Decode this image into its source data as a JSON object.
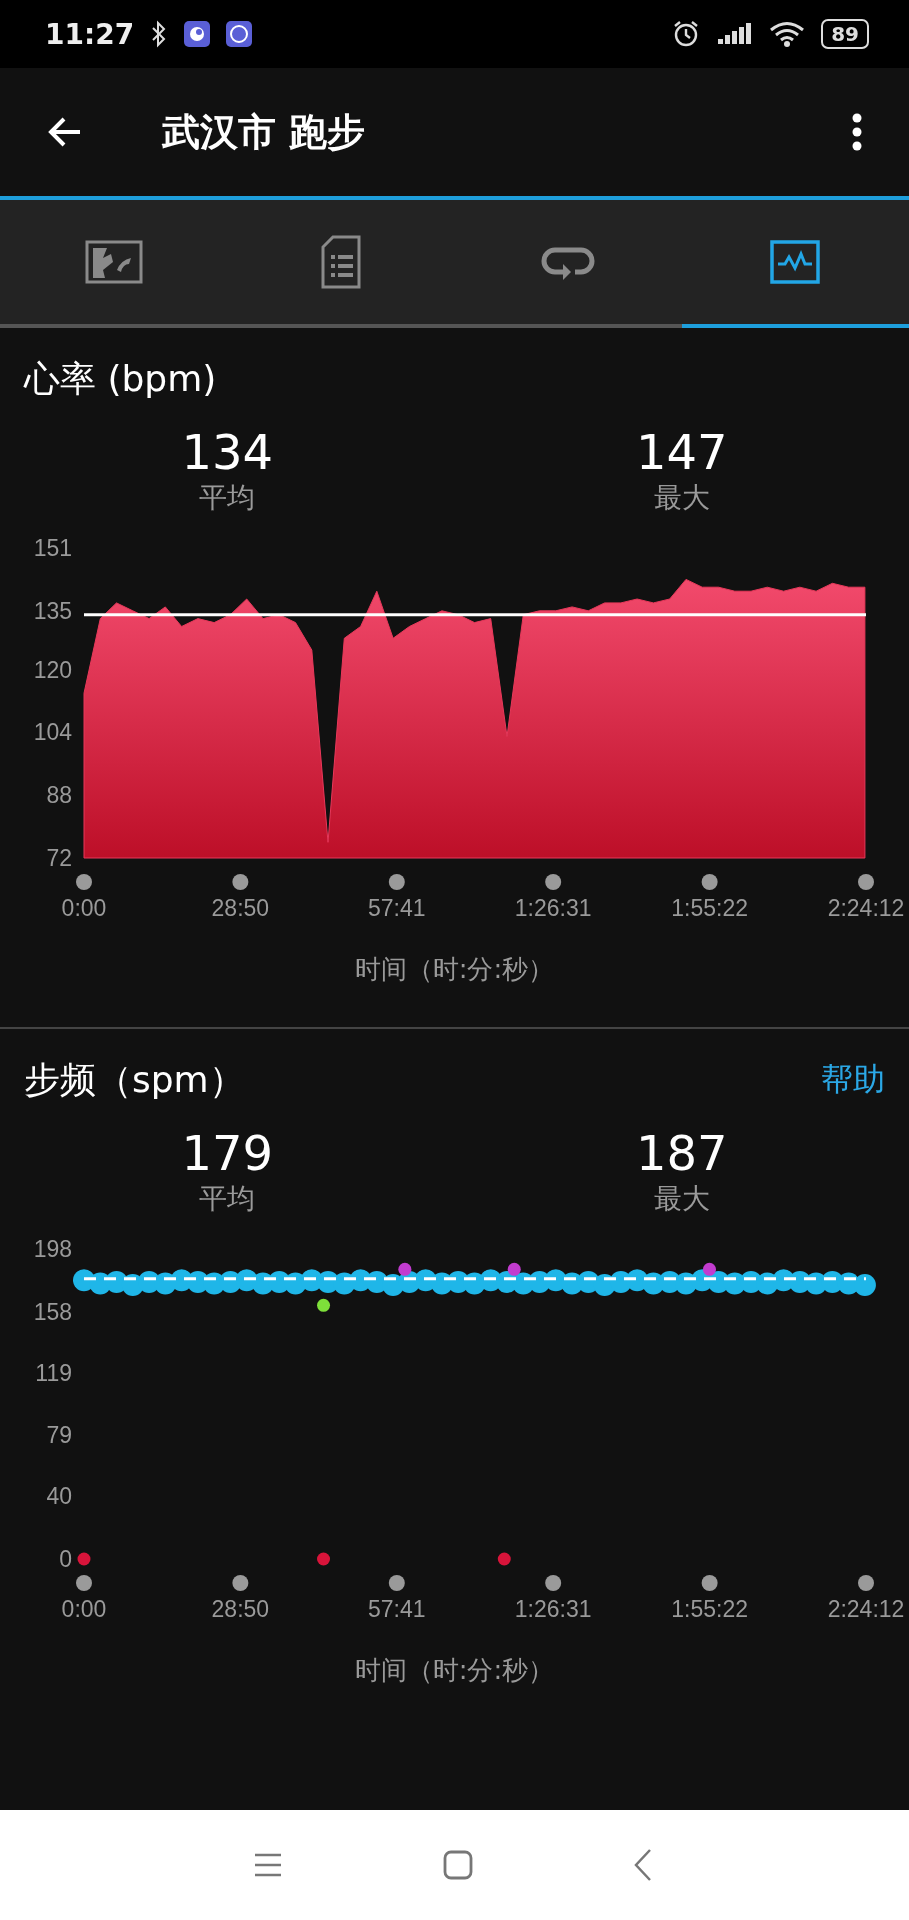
{
  "status_bar": {
    "time": "11:27",
    "battery": "89"
  },
  "header": {
    "title": "武汉市 跑步"
  },
  "tabs": [
    {
      "kind": "map",
      "selected": false
    },
    {
      "kind": "details",
      "selected": false
    },
    {
      "kind": "laps",
      "selected": false
    },
    {
      "kind": "charts",
      "selected": true
    }
  ],
  "sections": [
    {
      "title": "心率 (bpm)",
      "stats": [
        {
          "value": "134",
          "label": "平均"
        },
        {
          "value": "147",
          "label": "最大"
        }
      ],
      "chart_data": {
        "type": "area",
        "xlabel": "时间（时:分:秒）",
        "xlim": [
          0,
          8652
        ],
        "ylim": [
          72,
          151
        ],
        "yticks": [
          72,
          88,
          104,
          120,
          135,
          151
        ],
        "xticks": [
          {
            "value": 0,
            "label": "0:00"
          },
          {
            "value": 1730,
            "label": "28:50"
          },
          {
            "value": 3461,
            "label": "57:41"
          },
          {
            "value": 5191,
            "label": "1:26:31"
          },
          {
            "value": 6922,
            "label": "1:55:22"
          },
          {
            "value": 8652,
            "label": "2:24:12"
          }
        ],
        "x": [
          0,
          180,
          360,
          540,
          720,
          900,
          1080,
          1260,
          1440,
          1620,
          1800,
          1980,
          2160,
          2340,
          2520,
          2700,
          2880,
          3060,
          3240,
          3420,
          3600,
          3780,
          3960,
          4140,
          4320,
          4500,
          4680,
          4860,
          5040,
          5220,
          5400,
          5580,
          5760,
          5940,
          6120,
          6300,
          6480,
          6660,
          6840,
          7020,
          7200,
          7380,
          7560,
          7740,
          7920,
          8100,
          8280,
          8460,
          8640
        ],
        "series": [
          {
            "color": "#e8385a",
            "values": [
              114,
              133,
              137,
              135,
              133,
              136,
              131,
              133,
              132,
              134,
              138,
              133,
              134,
              132,
              125,
              76,
              128,
              131,
              140,
              128,
              131,
              133,
              135,
              134,
              132,
              133,
              103,
              134,
              135,
              135,
              136,
              135,
              137,
              137,
              138,
              137,
              138,
              143,
              141,
              141,
              140,
              140,
              141,
              140,
              141,
              140,
              142,
              141,
              141
            ]
          }
        ],
        "ref_lines": [
          {
            "axis": "y",
            "value": 134,
            "color": "#ffffff"
          }
        ]
      }
    },
    {
      "title": "步频（spm）",
      "help_link": "帮助",
      "stats": [
        {
          "value": "179",
          "label": "平均"
        },
        {
          "value": "187",
          "label": "最大"
        }
      ],
      "chart_data": {
        "type": "scatter",
        "xlabel": "时间（时:分:秒）",
        "xlim": [
          0,
          8652
        ],
        "ylim": [
          0,
          198
        ],
        "yticks": [
          0,
          40,
          79,
          119,
          158,
          198
        ],
        "xticks": [
          {
            "value": 0,
            "label": "0:00"
          },
          {
            "value": 1730,
            "label": "28:50"
          },
          {
            "value": 3461,
            "label": "57:41"
          },
          {
            "value": 5191,
            "label": "1:26:31"
          },
          {
            "value": 6922,
            "label": "1:55:22"
          },
          {
            "value": 8652,
            "label": "2:24:12"
          }
        ],
        "series": [
          {
            "color": "#1fb6e8",
            "x": [
              0,
              180,
              360,
              540,
              720,
              900,
              1080,
              1260,
              1440,
              1620,
              1800,
              1980,
              2160,
              2340,
              2520,
              2700,
              2880,
              3060,
              3240,
              3420,
              3600,
              3780,
              3960,
              4140,
              4320,
              4500,
              4680,
              4860,
              5040,
              5220,
              5400,
              5580,
              5760,
              5940,
              6120,
              6300,
              6480,
              6660,
              6840,
              7020,
              7200,
              7380,
              7560,
              7740,
              7920,
              8100,
              8280,
              8460,
              8640
            ],
            "values": [
              178,
              176,
              177,
              175,
              177,
              176,
              178,
              177,
              176,
              177,
              178,
              176,
              177,
              176,
              178,
              177,
              176,
              178,
              177,
              175,
              177,
              178,
              176,
              177,
              176,
              178,
              177,
              176,
              177,
              178,
              176,
              177,
              175,
              177,
              178,
              176,
              177,
              176,
              178,
              177,
              176,
              177,
              176,
              178,
              177,
              176,
              177,
              176,
              175
            ]
          },
          {
            "color": "#7ee03a",
            "x": [
              2650
            ],
            "values": [
              162
            ]
          },
          {
            "color": "#c23ccf",
            "x": [
              3550,
              4760,
              6920
            ],
            "values": [
              185,
              185,
              185
            ]
          },
          {
            "color": "#d8143a",
            "x": [
              0,
              2650,
              4650
            ],
            "values": [
              0,
              0,
              0
            ]
          }
        ],
        "ref_lines": [
          {
            "axis": "y",
            "value": 179,
            "color": "#ffffff"
          }
        ]
      }
    }
  ]
}
